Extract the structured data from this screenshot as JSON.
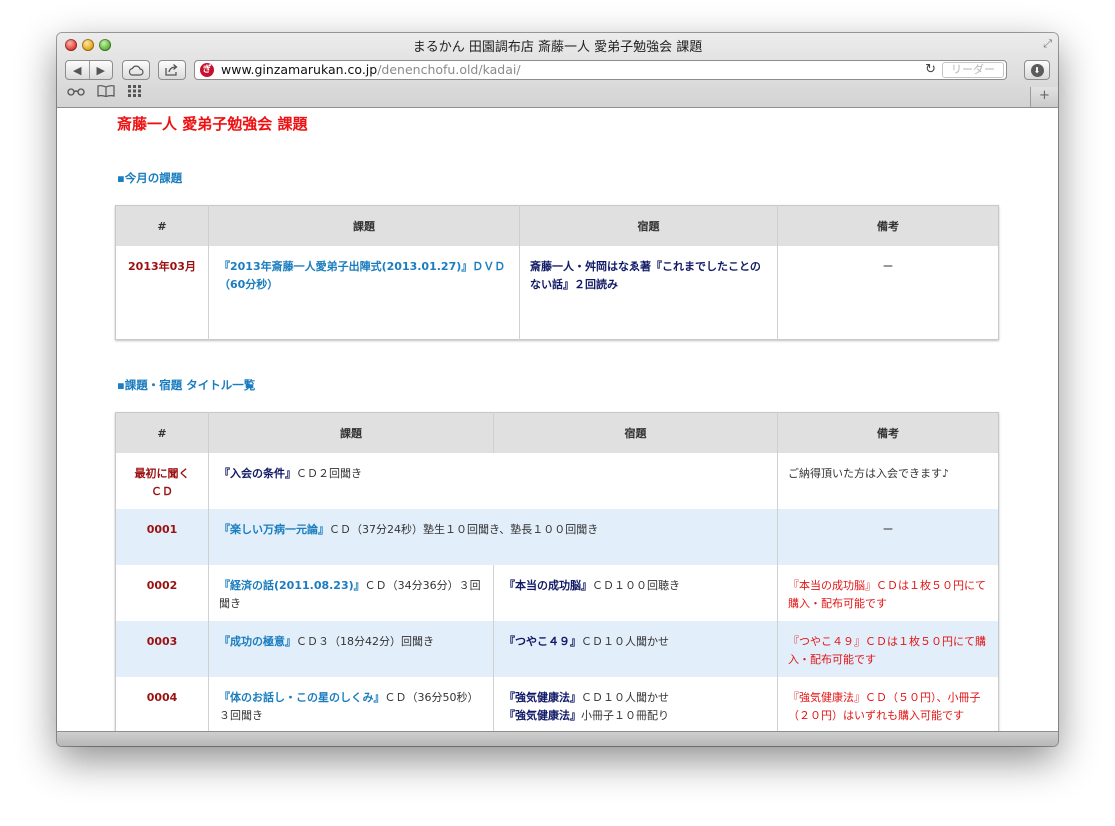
{
  "window": {
    "title": "まるかん 田園調布店 斎藤一人 愛弟子勉強会 課題"
  },
  "toolbar": {
    "back": "◀",
    "forward": "▶",
    "url_domain": "www.ginzamarukan.co.jp",
    "url_path": "/denenchofu.old/kadai/",
    "reader_label": "リーダー",
    "favicon_letter": "ぎ"
  },
  "page": {
    "title": "斎藤一人 愛弟子勉強会 課題",
    "section1_title": "▪今月の課題",
    "section2_title": "▪課題・宿題 タイトル一覧",
    "headers": {
      "num": "#",
      "kadai": "課題",
      "shukudai": "宿題",
      "biko": "備考"
    },
    "monthly": {
      "num": "2013年03月",
      "kadai": "『2013年斎藤一人愛弟子出陣式(2013.01.27)』ＤＶＤ（60分秒）",
      "shukudai": "斎藤一人・舛岡はなゑ著『これまでしたことのない話』２回読み",
      "biko": "ー"
    },
    "rows": [
      {
        "num": "最初に聞くＣＤ",
        "kadai_title": "『入会の条件』",
        "kadai_rest": "ＣＤ２回聞き",
        "biko": "ご納得頂いた方は入会できます♪"
      },
      {
        "num": "0001",
        "kadai_title": "『楽しい万病一元論』",
        "kadai_rest": "ＣＤ（37分24秒）塾生１０回聞き、塾長１００回聞き",
        "biko": "ー"
      },
      {
        "num": "0002",
        "kadai_title": "『経済の話(2011.08.23)』",
        "kadai_rest": "ＣＤ（34分36分）３回聞き",
        "shukudai_title": "『本当の成功脳』",
        "shukudai_rest": "ＣＤ１００回聴き",
        "biko": "『本当の成功脳』ＣＤは１枚５０円にて購入・配布可能です"
      },
      {
        "num": "0003",
        "kadai_title": "『成功の極意』",
        "kadai_rest": "ＣＤ３（18分42分）回聞き",
        "shukudai_title": "『つやこ４９』",
        "shukudai_rest": "ＣＤ１０人聞かせ",
        "biko": "『つやこ４９』ＣＤは１枚５０円にて購入・配布可能です"
      },
      {
        "num": "0004",
        "kadai_title": "『体のお話し・この星のしくみ』",
        "kadai_rest": "ＣＤ（36分50秒）３回聞き",
        "shukudai_title": "『強気健康法』",
        "shukudai_rest": "ＣＤ１０人聞かせ",
        "shukudai_title2": "『強気健康法』",
        "shukudai_rest2": "小冊子１０冊配り",
        "biko": "『強気健康法』ＣＤ（５０円）、小冊子（２０円）はいずれも購入可能です"
      }
    ]
  },
  "colors": {
    "title_red": "#ee1111",
    "link_blue": "#1a7dbf",
    "num_red": "#9b1010",
    "row_highlight": "#e2eef9"
  }
}
